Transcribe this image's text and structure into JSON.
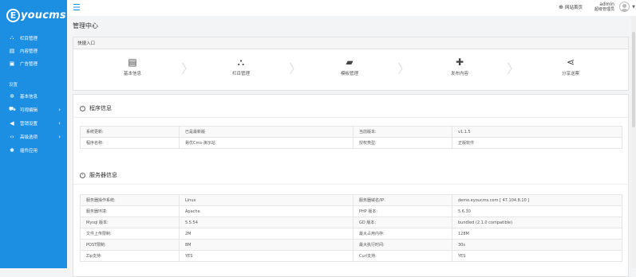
{
  "brand": {
    "logo_letter": "E",
    "logo_text": "youcms"
  },
  "sidebar": {
    "items": [
      {
        "label": "栏目管理",
        "icon": "sitemap-icon"
      },
      {
        "label": "内容管理",
        "icon": "list-icon"
      },
      {
        "label": "广告管理",
        "icon": "image-icon"
      }
    ],
    "settings_label": "设置",
    "settings_items": [
      {
        "label": "基本信息",
        "icon": "gear-icon",
        "chevron": ""
      },
      {
        "label": "可视编辑",
        "icon": "car-icon",
        "chevron": "›"
      },
      {
        "label": "营销设置",
        "icon": "megaphone-icon",
        "chevron": "›"
      },
      {
        "label": "高级选项",
        "icon": "code-icon",
        "chevron": "›"
      },
      {
        "label": "插件应用",
        "icon": "plugin-icon",
        "chevron": ""
      }
    ]
  },
  "topbar": {
    "menu_icon": "☰",
    "site_link": "网站首页",
    "username": "admin",
    "role": "超级管理员"
  },
  "page_title": "管理中心",
  "quick_entry": {
    "title": "快捷入口",
    "items": [
      {
        "label": "基本信息",
        "icon": "id-card-icon",
        "glyph": "▤"
      },
      {
        "label": "栏目管理",
        "icon": "sitemap-icon",
        "glyph": "⛬"
      },
      {
        "label": "模板管理",
        "icon": "folder-open-icon",
        "glyph": "▰"
      },
      {
        "label": "发布内容",
        "icon": "plus-icon",
        "glyph": "✚"
      },
      {
        "label": "分享送票",
        "icon": "share-icon",
        "glyph": "⋖"
      }
    ]
  },
  "program_info": {
    "title": "程序信息",
    "rows": [
      [
        "系统更新:",
        "已是最新版",
        "当前版本:",
        "v1.1.5"
      ],
      [
        "程序名称:",
        "易优Cms-演示站",
        "授权类型:",
        "正版软件"
      ]
    ]
  },
  "server_info": {
    "title": "服务器信息",
    "rows": [
      [
        "服务器操作系统:",
        "Linux",
        "服务器域名/IP:",
        "demo.eyoucms.com [ 47.104.8.10 ]"
      ],
      [
        "服务器环境:",
        "Apache",
        "PHP 版本:",
        "5.6.30"
      ],
      [
        "Mysql 版本:",
        "5.5.54",
        "GD 版本:",
        "bundled (2.1.0 compatible)"
      ],
      [
        "文件上传限制:",
        "2M",
        "最大占用内存:",
        "128M"
      ],
      [
        "POST限制:",
        "8M",
        "最大执行时间:",
        "30s"
      ],
      [
        "Zip支持:",
        "YES",
        "Curl支持:",
        "YES"
      ]
    ]
  },
  "colors": {
    "sidebar_bg": "#1d8fe3",
    "page_bg": "#f3f4f6",
    "accent": "#1d8fe3"
  }
}
